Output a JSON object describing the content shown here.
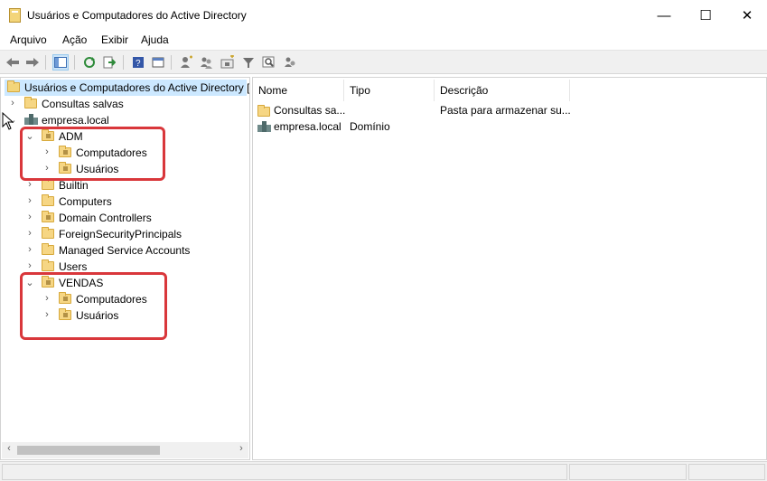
{
  "window": {
    "title": "Usuários e Computadores do Active Directory",
    "minimize": "—",
    "maximize": "☐",
    "close": "✕"
  },
  "menu": [
    "Arquivo",
    "Ação",
    "Exibir",
    "Ajuda"
  ],
  "toolbar": {
    "icons": [
      "back-icon",
      "forward-icon",
      "show-hide-console-tree-icon",
      "refresh-icon",
      "export-list-icon",
      "help-icon",
      "properties-icon",
      "add-user-icon",
      "add-group-icon",
      "add-ou-icon",
      "filter-icon",
      "find-icon",
      "add-to-group-icon"
    ]
  },
  "tree": {
    "root": "Usuários e Computadores do Active Directory [",
    "saved_queries": "Consultas salvas",
    "domain": "empresa.local",
    "ou_adm": "ADM",
    "adm_children": [
      "Computadores",
      "Usuários"
    ],
    "containers": [
      "Builtin",
      "Computers",
      "Domain Controllers",
      "ForeignSecurityPrincipals",
      "Managed Service Accounts",
      "Users"
    ],
    "ou_vendas": "VENDAS",
    "vendas_children": [
      "Computadores",
      "Usuários"
    ]
  },
  "list": {
    "columns": [
      "Nome",
      "Tipo",
      "Descrição"
    ],
    "rows": [
      {
        "name": "Consultas sa...",
        "type": "",
        "description": "Pasta para armazenar su..."
      },
      {
        "name": "empresa.local",
        "type": "Domínio",
        "description": ""
      }
    ]
  },
  "colors": {
    "highlight_box": "#d9373b",
    "selected_row": "#cce8ff",
    "folder": "#f6d684"
  }
}
